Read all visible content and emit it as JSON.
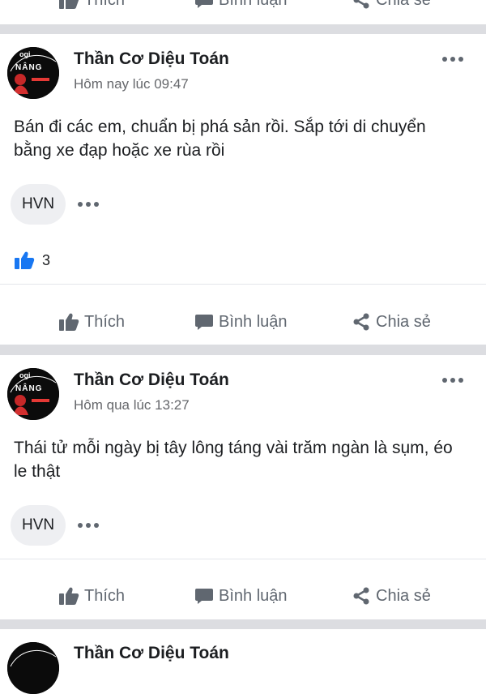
{
  "actions": {
    "like": "Thích",
    "comment": "Bình luận",
    "share": "Chia sẻ"
  },
  "posts": [
    {
      "author": "Thần Cơ Diệu Toán",
      "time": "Hôm nay lúc 09:47",
      "text": "Bán đi các em, chuẩn bị phá sản rồi. Sắp tới di chuyển bằng xe đạp hoặc xe rùa rồi",
      "tag": "HVN",
      "like_count": "3"
    },
    {
      "author": "Thần Cơ Diệu Toán",
      "time": "Hôm qua lúc 13:27",
      "text": "Thái tử mỗi ngày bị tây lông táng vài trăm ngàn là sụm, éo le thật",
      "tag": "HVN"
    }
  ],
  "avatar_text": {
    "top": "ogi",
    "bottom": "NÂNG"
  },
  "colors": {
    "like_blue": "#1877f2",
    "separator": "#dcdde1",
    "icon_gray": "#606770"
  }
}
